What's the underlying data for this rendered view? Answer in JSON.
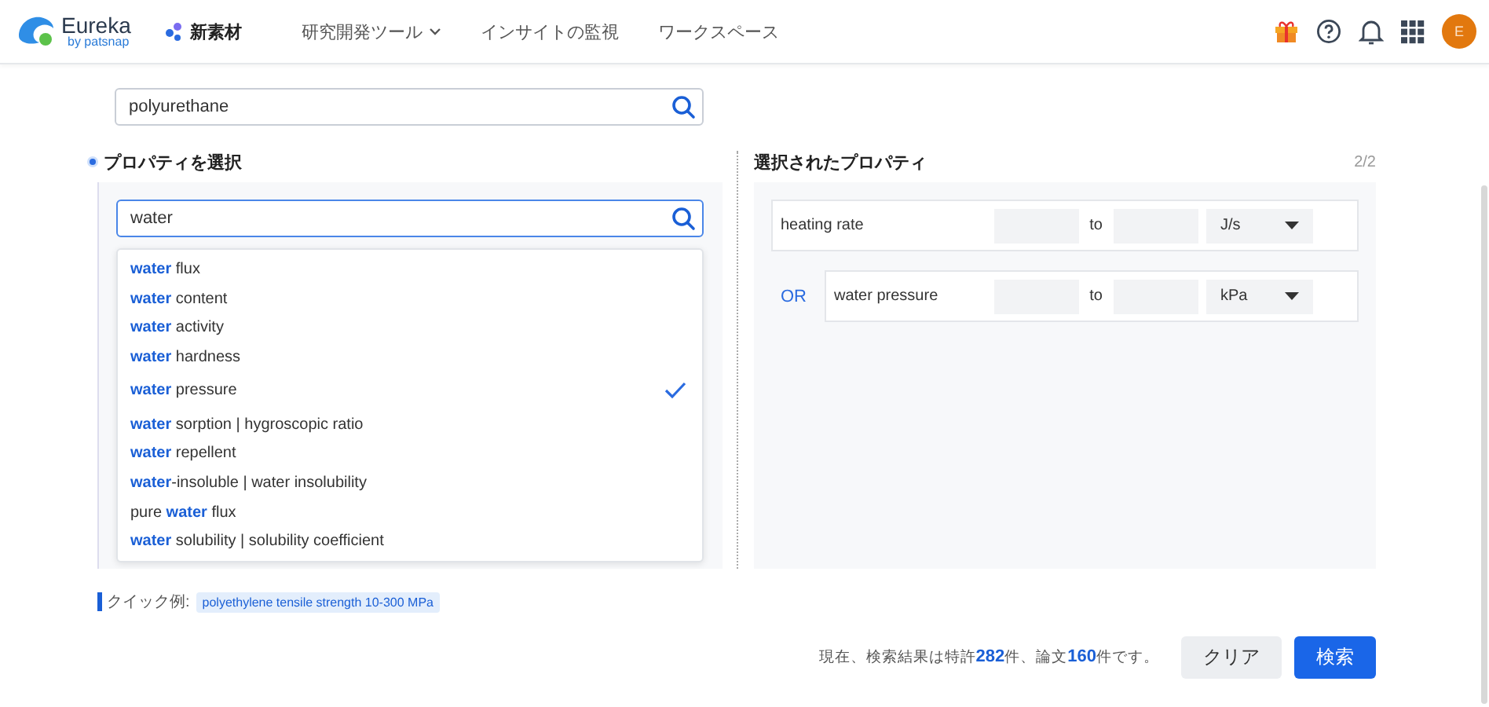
{
  "header": {
    "logo": {
      "name": "Eureka",
      "sub": "by patsnap"
    },
    "nav": [
      {
        "label": "新素材",
        "selected": true,
        "has_menu": false
      },
      {
        "label": "研究開発ツール",
        "selected": false,
        "has_menu": true
      },
      {
        "label": "インサイトの監視",
        "selected": false,
        "has_menu": false
      },
      {
        "label": "ワークスペース",
        "selected": false,
        "has_menu": false
      }
    ],
    "avatar": "E"
  },
  "search": {
    "value": "polyurethane"
  },
  "property_picker": {
    "title": "プロパティを選択",
    "query": "water",
    "suggestions": [
      {
        "text": "**water** flux",
        "selected": false
      },
      {
        "text": "**water** content",
        "selected": false
      },
      {
        "text": "**water** activity",
        "selected": false
      },
      {
        "text": "**water** hardness",
        "selected": false
      },
      {
        "text": "**water** pressure",
        "selected": true
      },
      {
        "text": "**water** sorption | hygroscopic ratio",
        "selected": false
      },
      {
        "text": "**water** repellent",
        "selected": false
      },
      {
        "text": "**water**-insoluble | water insolubility",
        "selected": false
      },
      {
        "text": "pure **water** flux",
        "selected": false
      },
      {
        "text": "**water** solubility | solubility coefficient",
        "selected": false
      }
    ]
  },
  "selected_properties": {
    "title": "選択されたプロパティ",
    "count": "2/2",
    "rows": [
      {
        "connector": null,
        "name": "heating rate",
        "to": "to",
        "unit": "J/s"
      },
      {
        "connector": "OR",
        "name": "water pressure",
        "to": "to",
        "unit": "kPa"
      }
    ]
  },
  "quick_example": {
    "label": "クイック例:",
    "tag": "polyethylene tensile strength 10-300 MPa"
  },
  "footer": {
    "result_text": "現在、検索結果は特許**282**件、論文**160**件です。",
    "buttons": [
      {
        "label": "クリア",
        "kind": "secondary"
      },
      {
        "label": "検索",
        "kind": "primary"
      }
    ]
  }
}
